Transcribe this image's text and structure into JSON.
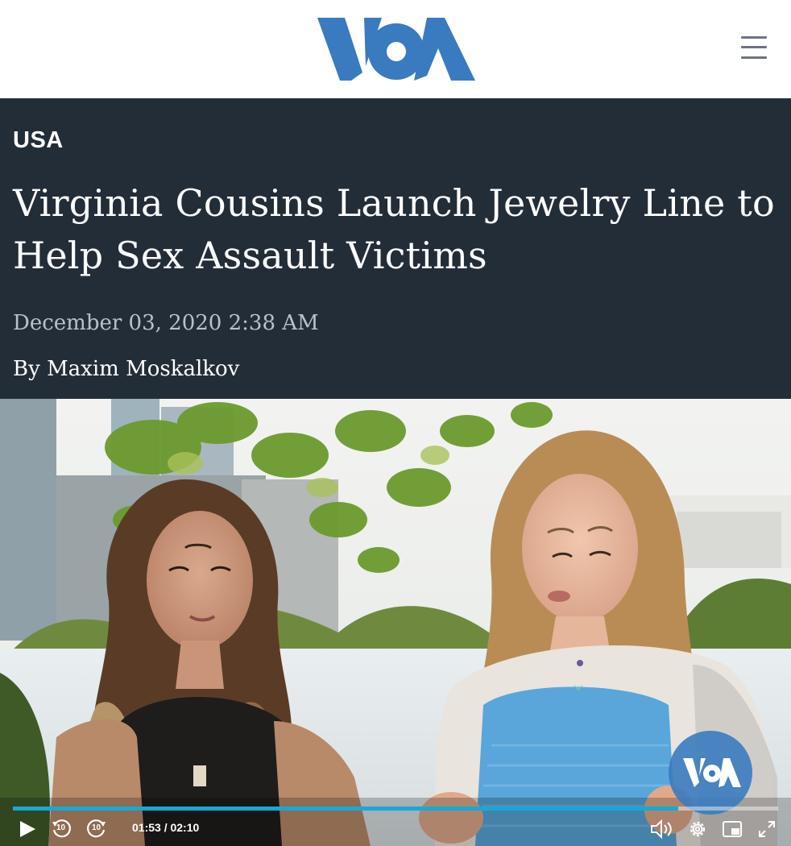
{
  "header": {
    "logo_icon": "voa-logo",
    "menu_icon": "hamburger-menu-icon"
  },
  "article": {
    "section": "USA",
    "headline": "Virginia Cousins Launch Jewelry Line to Help Sex Assault Victims",
    "date": "December 03, 2020 2:38 AM",
    "byline_prefix": "By",
    "author": "Maxim Moskalkov"
  },
  "video": {
    "time_current": "01:53",
    "time_total": "02:10",
    "progress_fraction": 0.869,
    "rewind_seconds": "10",
    "forward_seconds": "10",
    "watermark_icon": "voa-logo",
    "accent_color": "#16a9d8"
  },
  "colors": {
    "brand_blue": "#3a7bbf",
    "hero_bg": "#232d38"
  }
}
